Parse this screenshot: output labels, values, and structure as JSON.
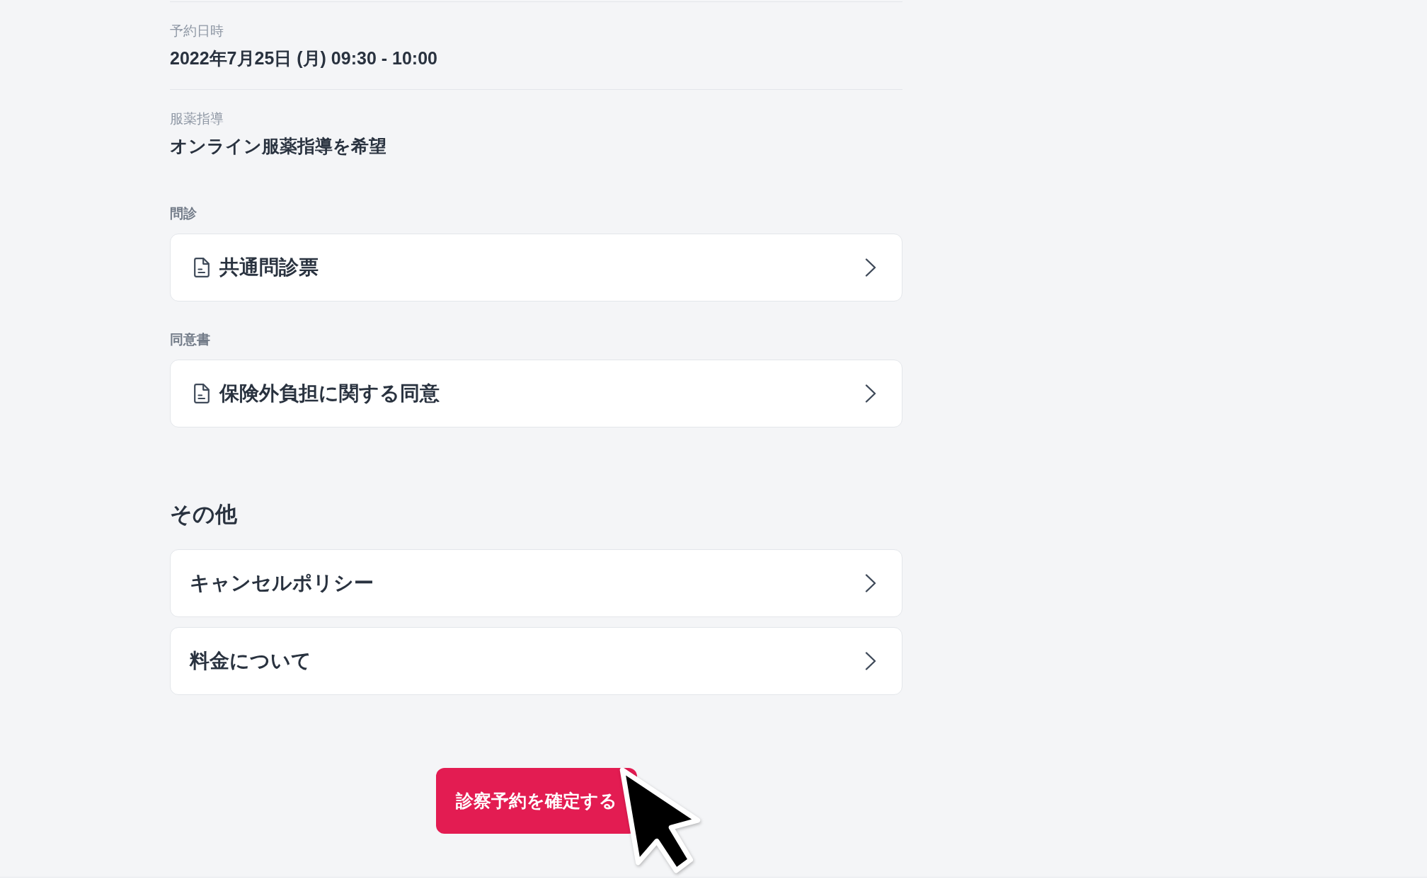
{
  "details": [
    {
      "label": "予約日時",
      "value": "2022年7月25日 (月) 09:30 - 10:00"
    },
    {
      "label": "服薬指導",
      "value": "オンライン服薬指導を希望"
    }
  ],
  "document_groups": [
    {
      "label": "問診",
      "items": [
        {
          "title": "共通問診票"
        }
      ]
    },
    {
      "label": "同意書",
      "items": [
        {
          "title": "保険外負担に関する同意"
        }
      ]
    }
  ],
  "other": {
    "heading": "その他",
    "items": [
      {
        "title": "キャンセルポリシー"
      },
      {
        "title": "料金について"
      }
    ]
  },
  "confirm_button": {
    "label": "診察予約を確定する"
  }
}
